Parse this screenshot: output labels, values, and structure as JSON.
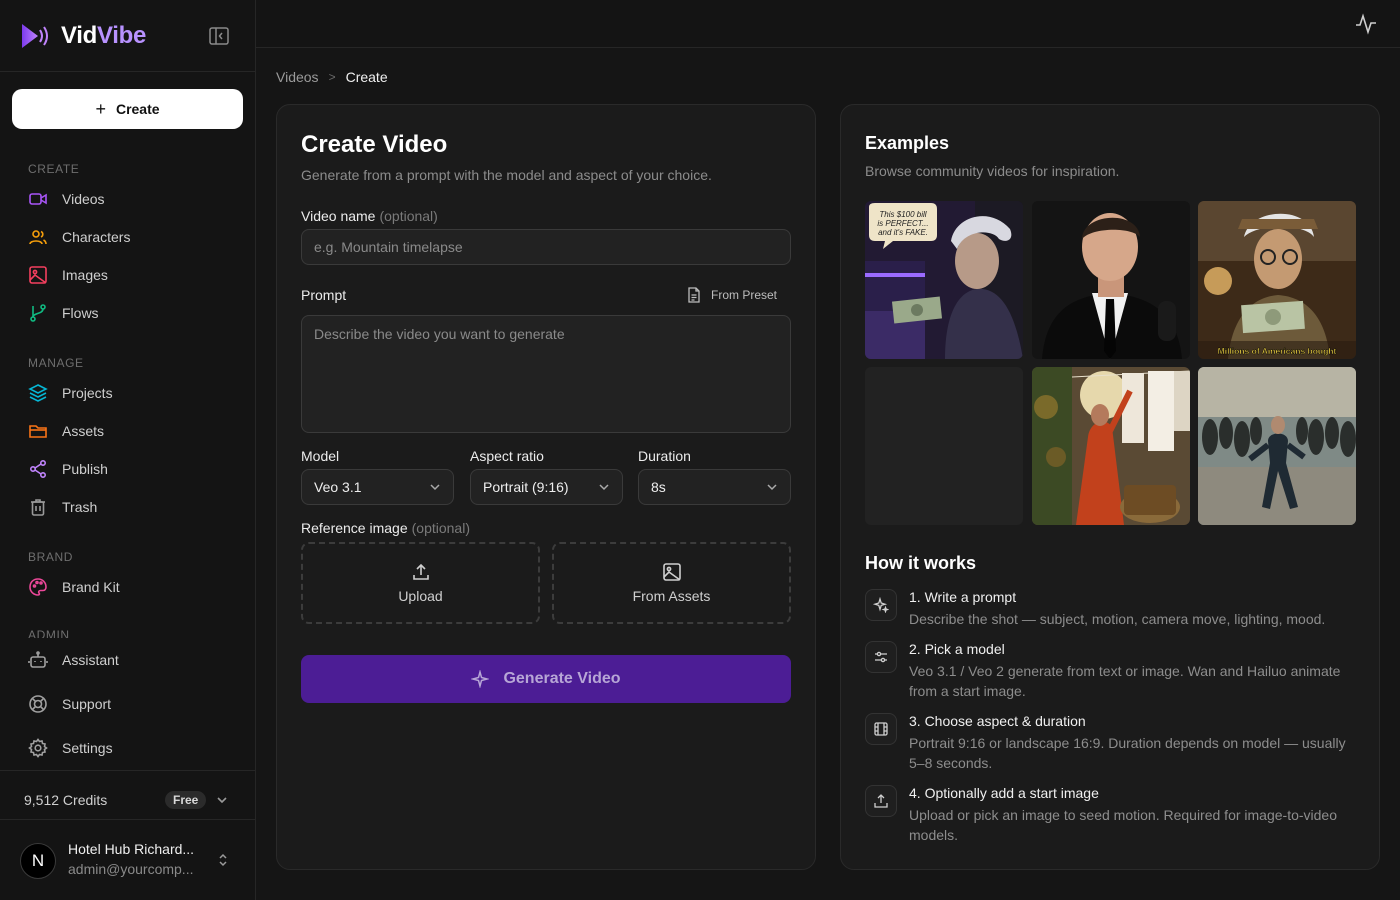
{
  "app": {
    "brand_part1": "Vid",
    "brand_part2": "Vibe",
    "accent_color": "#7c3aed"
  },
  "sidebar": {
    "create_label": "Create",
    "sections": {
      "create": "CREATE",
      "manage": "MANAGE",
      "brand": "BRAND",
      "admin": "ADMIN"
    },
    "items": {
      "videos": "Videos",
      "characters": "Characters",
      "images": "Images",
      "flows": "Flows",
      "projects": "Projects",
      "assets": "Assets",
      "publish": "Publish",
      "trash": "Trash",
      "brand_kit": "Brand Kit",
      "assistant": "Assistant",
      "support": "Support",
      "settings": "Settings"
    },
    "credits": "9,512 Credits",
    "plan_badge": "Free",
    "user": {
      "initial": "N",
      "name": "Hotel Hub Richard...",
      "email": "admin@yourcomp..."
    }
  },
  "breadcrumb": {
    "parent": "Videos",
    "separator": ">",
    "current": "Create"
  },
  "form": {
    "title": "Create Video",
    "subtitle": "Generate from a prompt with the model and aspect of your choice.",
    "video_name_label": "Video name",
    "optional_text": "(optional)",
    "video_name_placeholder": "e.g. Mountain timelapse",
    "video_name_value": "",
    "prompt_label": "Prompt",
    "from_preset": "From Preset",
    "prompt_placeholder": "Describe the video you want to generate",
    "model_label": "Model",
    "model_value": "Veo 3.1",
    "aspect_label": "Aspect ratio",
    "aspect_value": "Portrait (9:16)",
    "duration_label": "Duration",
    "duration_value": "8s",
    "reference_label": "Reference image",
    "upload_label": "Upload",
    "from_assets_label": "From Assets",
    "generate_label": "Generate Video"
  },
  "examples": {
    "title": "Examples",
    "subtitle": "Browse community videos for inspiration.",
    "thumbnails": [
      {
        "id": "old-man-bill",
        "caption": "This $100 bill is PERFECT... and it's FAKE."
      },
      {
        "id": "man-in-suit",
        "caption": ""
      },
      {
        "id": "old-man-money",
        "caption": "Millions of Americans bought"
      },
      {
        "id": "empty",
        "caption": ""
      },
      {
        "id": "woman-laundry",
        "caption": ""
      },
      {
        "id": "crowd-running",
        "caption": ""
      }
    ]
  },
  "how_it_works": {
    "title": "How it works",
    "steps": [
      {
        "title": "1. Write a prompt",
        "desc": "Describe the shot — subject, motion, camera move, lighting, mood.",
        "icon": "sparkles-icon"
      },
      {
        "title": "2. Pick a model",
        "desc": "Veo 3.1 / Veo 2 generate from text or image. Wan and Hailuo animate from a start image.",
        "icon": "sliders-icon"
      },
      {
        "title": "3. Choose aspect & duration",
        "desc": "Portrait 9:16 or landscape 16:9. Duration depends on model — usually 5–8 seconds.",
        "icon": "film-icon"
      },
      {
        "title": "4. Optionally add a start image",
        "desc": "Upload or pick an image to seed motion. Required for image-to-video models.",
        "icon": "upload-icon"
      }
    ]
  }
}
